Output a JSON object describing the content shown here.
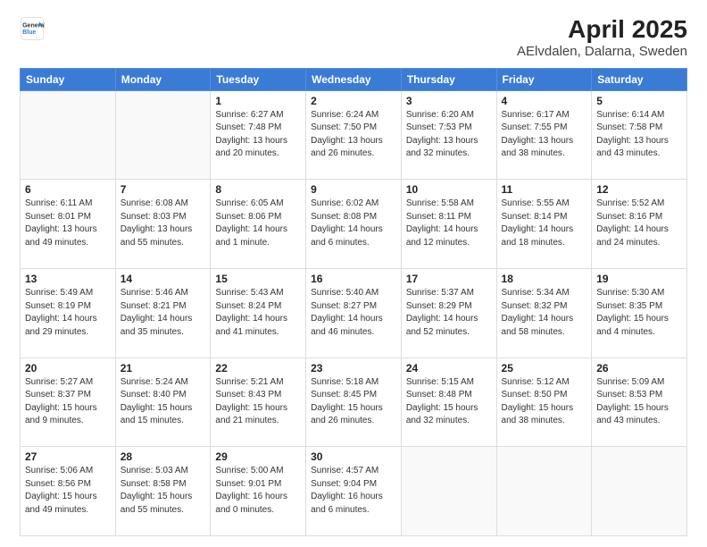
{
  "header": {
    "logo_line1": "General",
    "logo_line2": "Blue",
    "title": "April 2025",
    "subtitle": "AElvdalen, Dalarna, Sweden"
  },
  "weekdays": [
    "Sunday",
    "Monday",
    "Tuesday",
    "Wednesday",
    "Thursday",
    "Friday",
    "Saturday"
  ],
  "weeks": [
    [
      {
        "day": "",
        "info": ""
      },
      {
        "day": "",
        "info": ""
      },
      {
        "day": "1",
        "info": "Sunrise: 6:27 AM\nSunset: 7:48 PM\nDaylight: 13 hours\nand 20 minutes."
      },
      {
        "day": "2",
        "info": "Sunrise: 6:24 AM\nSunset: 7:50 PM\nDaylight: 13 hours\nand 26 minutes."
      },
      {
        "day": "3",
        "info": "Sunrise: 6:20 AM\nSunset: 7:53 PM\nDaylight: 13 hours\nand 32 minutes."
      },
      {
        "day": "4",
        "info": "Sunrise: 6:17 AM\nSunset: 7:55 PM\nDaylight: 13 hours\nand 38 minutes."
      },
      {
        "day": "5",
        "info": "Sunrise: 6:14 AM\nSunset: 7:58 PM\nDaylight: 13 hours\nand 43 minutes."
      }
    ],
    [
      {
        "day": "6",
        "info": "Sunrise: 6:11 AM\nSunset: 8:01 PM\nDaylight: 13 hours\nand 49 minutes."
      },
      {
        "day": "7",
        "info": "Sunrise: 6:08 AM\nSunset: 8:03 PM\nDaylight: 13 hours\nand 55 minutes."
      },
      {
        "day": "8",
        "info": "Sunrise: 6:05 AM\nSunset: 8:06 PM\nDaylight: 14 hours\nand 1 minute."
      },
      {
        "day": "9",
        "info": "Sunrise: 6:02 AM\nSunset: 8:08 PM\nDaylight: 14 hours\nand 6 minutes."
      },
      {
        "day": "10",
        "info": "Sunrise: 5:58 AM\nSunset: 8:11 PM\nDaylight: 14 hours\nand 12 minutes."
      },
      {
        "day": "11",
        "info": "Sunrise: 5:55 AM\nSunset: 8:14 PM\nDaylight: 14 hours\nand 18 minutes."
      },
      {
        "day": "12",
        "info": "Sunrise: 5:52 AM\nSunset: 8:16 PM\nDaylight: 14 hours\nand 24 minutes."
      }
    ],
    [
      {
        "day": "13",
        "info": "Sunrise: 5:49 AM\nSunset: 8:19 PM\nDaylight: 14 hours\nand 29 minutes."
      },
      {
        "day": "14",
        "info": "Sunrise: 5:46 AM\nSunset: 8:21 PM\nDaylight: 14 hours\nand 35 minutes."
      },
      {
        "day": "15",
        "info": "Sunrise: 5:43 AM\nSunset: 8:24 PM\nDaylight: 14 hours\nand 41 minutes."
      },
      {
        "day": "16",
        "info": "Sunrise: 5:40 AM\nSunset: 8:27 PM\nDaylight: 14 hours\nand 46 minutes."
      },
      {
        "day": "17",
        "info": "Sunrise: 5:37 AM\nSunset: 8:29 PM\nDaylight: 14 hours\nand 52 minutes."
      },
      {
        "day": "18",
        "info": "Sunrise: 5:34 AM\nSunset: 8:32 PM\nDaylight: 14 hours\nand 58 minutes."
      },
      {
        "day": "19",
        "info": "Sunrise: 5:30 AM\nSunset: 8:35 PM\nDaylight: 15 hours\nand 4 minutes."
      }
    ],
    [
      {
        "day": "20",
        "info": "Sunrise: 5:27 AM\nSunset: 8:37 PM\nDaylight: 15 hours\nand 9 minutes."
      },
      {
        "day": "21",
        "info": "Sunrise: 5:24 AM\nSunset: 8:40 PM\nDaylight: 15 hours\nand 15 minutes."
      },
      {
        "day": "22",
        "info": "Sunrise: 5:21 AM\nSunset: 8:43 PM\nDaylight: 15 hours\nand 21 minutes."
      },
      {
        "day": "23",
        "info": "Sunrise: 5:18 AM\nSunset: 8:45 PM\nDaylight: 15 hours\nand 26 minutes."
      },
      {
        "day": "24",
        "info": "Sunrise: 5:15 AM\nSunset: 8:48 PM\nDaylight: 15 hours\nand 32 minutes."
      },
      {
        "day": "25",
        "info": "Sunrise: 5:12 AM\nSunset: 8:50 PM\nDaylight: 15 hours\nand 38 minutes."
      },
      {
        "day": "26",
        "info": "Sunrise: 5:09 AM\nSunset: 8:53 PM\nDaylight: 15 hours\nand 43 minutes."
      }
    ],
    [
      {
        "day": "27",
        "info": "Sunrise: 5:06 AM\nSunset: 8:56 PM\nDaylight: 15 hours\nand 49 minutes."
      },
      {
        "day": "28",
        "info": "Sunrise: 5:03 AM\nSunset: 8:58 PM\nDaylight: 15 hours\nand 55 minutes."
      },
      {
        "day": "29",
        "info": "Sunrise: 5:00 AM\nSunset: 9:01 PM\nDaylight: 16 hours\nand 0 minutes."
      },
      {
        "day": "30",
        "info": "Sunrise: 4:57 AM\nSunset: 9:04 PM\nDaylight: 16 hours\nand 6 minutes."
      },
      {
        "day": "",
        "info": ""
      },
      {
        "day": "",
        "info": ""
      },
      {
        "day": "",
        "info": ""
      }
    ]
  ]
}
